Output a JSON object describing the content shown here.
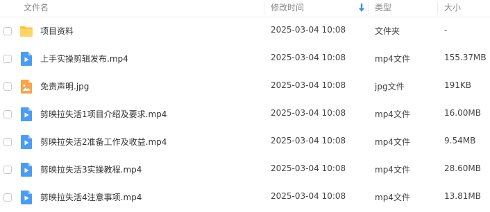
{
  "header": {
    "name_label": "文件名",
    "modified_label": "修改时间",
    "type_label": "类型",
    "size_label": "大小",
    "sort_icon": "arrow-down-icon",
    "sort_color": "#3b8cff"
  },
  "files": [
    {
      "name": "项目资料",
      "modified": "2025-03-04 10:08",
      "type": "文件夹",
      "size": "-",
      "icon": "folder-icon"
    },
    {
      "name": "上手实操剪辑发布.mp4",
      "modified": "2025-03-04 10:08",
      "type": "mp4文件",
      "size": "155.37MB",
      "icon": "video-file-icon"
    },
    {
      "name": "免责声明.jpg",
      "modified": "2025-03-04 10:08",
      "type": "jpg文件",
      "size": "191KB",
      "icon": "image-file-icon"
    },
    {
      "name": "剪映拉失活1项目介绍及要求.mp4",
      "modified": "2025-03-04 10:08",
      "type": "mp4文件",
      "size": "16.00MB",
      "icon": "video-file-icon"
    },
    {
      "name": "剪映拉失活2准备工作及收益.mp4",
      "modified": "2025-03-04 10:08",
      "type": "mp4文件",
      "size": "9.54MB",
      "icon": "video-file-icon"
    },
    {
      "name": "剪映拉失活3实操教程.mp4",
      "modified": "2025-03-04 10:08",
      "type": "mp4文件",
      "size": "28.60MB",
      "icon": "video-file-icon"
    },
    {
      "name": "剪映拉失活4注意事项.mp4",
      "modified": "2025-03-04 10:08",
      "type": "mp4文件",
      "size": "13.81MB",
      "icon": "video-file-icon"
    }
  ],
  "colors": {
    "folder": "#ffc53d",
    "video": "#4a9cf5",
    "image": "#f7a44a"
  }
}
